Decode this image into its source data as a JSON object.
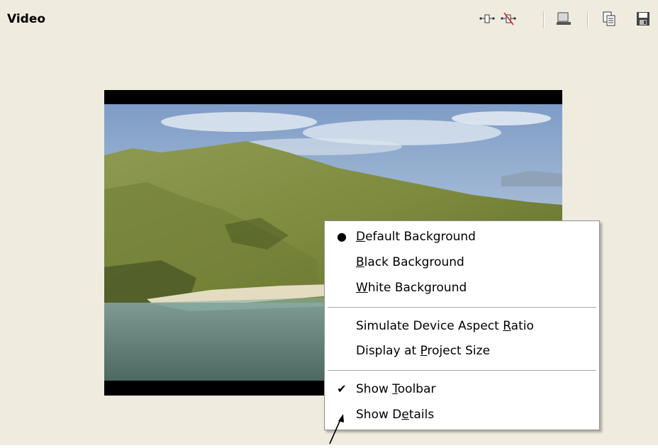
{
  "panel": {
    "title": "Video"
  },
  "toolbar": {
    "icons": [
      "snap-markers-icon",
      "delete-markers-icon",
      "preview-window-icon",
      "copy-icon",
      "save-icon"
    ]
  },
  "context_menu": {
    "items": [
      {
        "pre": "",
        "ul": "D",
        "post": "efault Background",
        "mark": "●"
      },
      {
        "pre": "",
        "ul": "B",
        "post": "lack Background",
        "mark": ""
      },
      {
        "pre": "",
        "ul": "W",
        "post": "hite Background",
        "mark": ""
      },
      {
        "pre": "Simulate Device Aspect ",
        "ul": "R",
        "post": "atio",
        "mark": ""
      },
      {
        "pre": "Display at ",
        "ul": "P",
        "post": "roject Size",
        "mark": ""
      },
      {
        "pre": "Show ",
        "ul": "T",
        "post": "oolbar",
        "mark": "✔"
      },
      {
        "pre": "Show D",
        "ul": "e",
        "post": "tails",
        "mark": ""
      }
    ]
  },
  "colors": {
    "panel_bg": "#f0ebdf",
    "menu_bg": "#ffffff",
    "letterbox": "#000000"
  }
}
